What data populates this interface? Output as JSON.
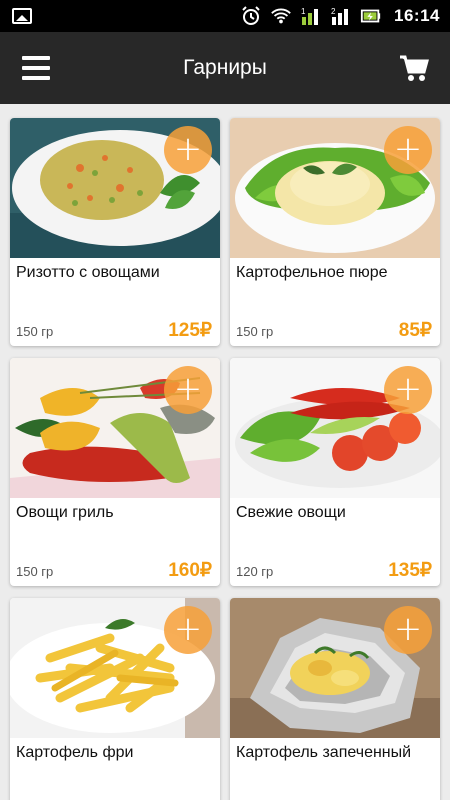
{
  "status_bar": {
    "time": "16:14",
    "icons": [
      "gallery-icon",
      "alarm-icon",
      "wifi-icon",
      "signal-1-icon",
      "signal-2-icon",
      "battery-charging-icon"
    ]
  },
  "app_bar": {
    "title": "Гарниры",
    "menu_icon": "hamburger-menu-icon",
    "cart_icon": "cart-icon"
  },
  "colors": {
    "accent": "#f39c12",
    "add_button": "#f7a038",
    "app_bar": "#282828"
  },
  "add_button_symbol": "+",
  "products": [
    {
      "name": "Ризотто с овощами",
      "weight": "150 гр",
      "price": "125₽"
    },
    {
      "name": "Картофельное пюре",
      "weight": "150 гр",
      "price": "85₽"
    },
    {
      "name": "Овощи гриль",
      "weight": "150 гр",
      "price": "160₽"
    },
    {
      "name": "Свежие овощи",
      "weight": "120 гр",
      "price": "135₽"
    },
    {
      "name": "Картофель фри",
      "weight": "",
      "price": ""
    },
    {
      "name": "Картофель запеченный",
      "weight": "",
      "price": ""
    }
  ]
}
